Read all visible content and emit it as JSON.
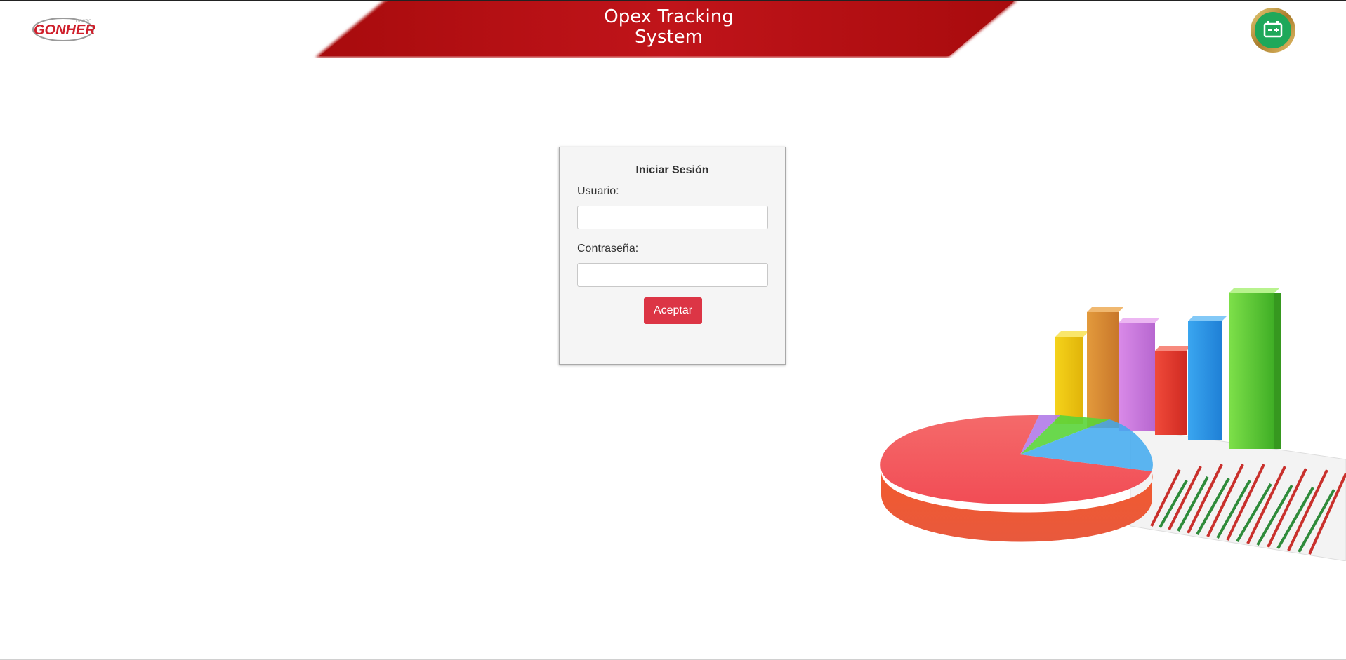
{
  "header": {
    "title_line1": "Opex Tracking",
    "title_line2": "System"
  },
  "logo": {
    "brand": "GONHER",
    "small_text": "GRUPO",
    "icon": "gonher-logo"
  },
  "app_badge": {
    "icon": "battery-icon"
  },
  "login": {
    "title": "Iniciar Sesión",
    "user_label": "Usuario:",
    "user_value": "",
    "user_placeholder": "",
    "password_label": "Contraseña:",
    "password_value": "",
    "password_placeholder": "",
    "submit_label": "Aceptar"
  },
  "colors": {
    "banner_red": "#b50e10",
    "button_red": "#dc3545",
    "badge_green": "#1ea85a",
    "badge_gold": "#c9a24b"
  },
  "illustration": {
    "icon": "charts-illustration"
  }
}
